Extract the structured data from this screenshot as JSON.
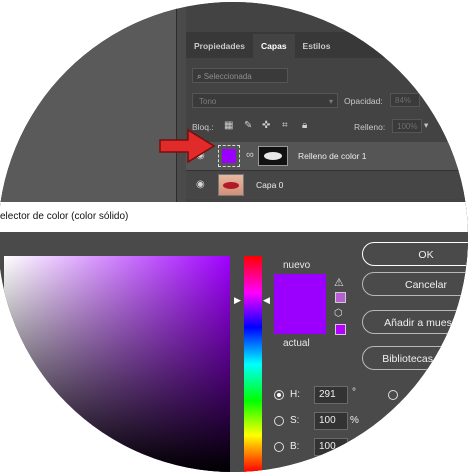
{
  "layers_panel": {
    "tabs": [
      "Propiedades",
      "Capas",
      "Estilos"
    ],
    "active_tab": "Capas",
    "search_placeholder": "Seleccionada",
    "blend_mode": "Tono",
    "opacity_label": "Opacidad:",
    "opacity_value": "84%",
    "lock_label": "Bloq.:",
    "fill_label": "Relleno:",
    "fill_value": "100%",
    "layers": [
      {
        "name": "Relleno de color 1",
        "selected": true,
        "swatch": "#9b00ff"
      },
      {
        "name": "Capa 0",
        "selected": false
      }
    ]
  },
  "dialog": {
    "title": "elector de color (color sólido)",
    "nuevo_label": "nuevo",
    "actual_label": "actual",
    "new_color": "#9b00ff",
    "current_color": "#9b00ff",
    "buttons": {
      "ok": "OK",
      "cancel": "Cancelar",
      "add": "Añadir a mues",
      "libraries": "Bibliotecas d"
    },
    "hsb": {
      "h_label": "H:",
      "h_value": "291",
      "h_unit": "°",
      "s_label": "S:",
      "s_value": "100",
      "s_unit": "%",
      "b_label": "B:",
      "b_value": "100"
    }
  }
}
